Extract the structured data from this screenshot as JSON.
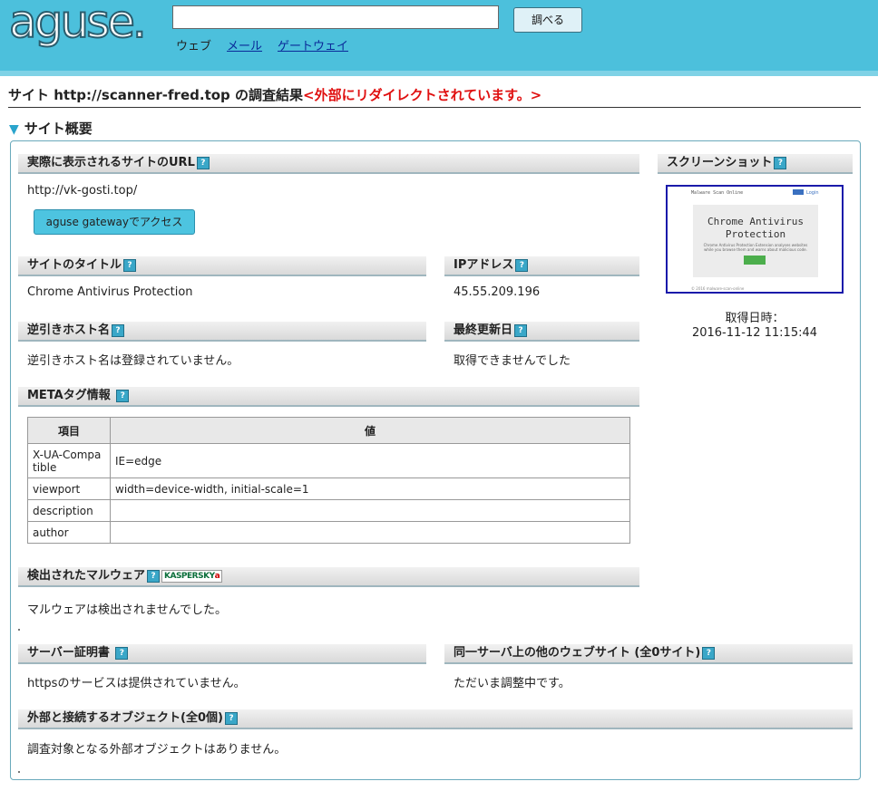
{
  "header": {
    "logo": "aguse.",
    "search_placeholder": "",
    "search_button": "調べる",
    "nav": [
      "ウェブ",
      "メール",
      "ゲートウェイ"
    ]
  },
  "page_title": {
    "prefix": "サイト http://scanner-fred.top の調査結果",
    "redirect_notice": "<外部にリダイレクトされています。>"
  },
  "section": {
    "title": "サイト概要"
  },
  "actual_url": {
    "label": "実際に表示されるサイトのURL",
    "value": "http://vk-gosti.top/",
    "gateway_button": "aguse gatewayでアクセス"
  },
  "screenshot": {
    "label": "スクリーンショット",
    "nav_text": "Malware Scan Online",
    "site_title": "Chrome Antivirus Protection",
    "site_desc": "Chrome Antivirus Protection Extension analyses websites while you browse them and warns about malicious code.",
    "button_text": "Install",
    "footer_text": "© 2016 malware-scan-online",
    "date_label": "取得日時：",
    "date_value": "2016-11-12 11:15:44"
  },
  "site_title": {
    "label": "サイトのタイトル",
    "value": "Chrome Antivirus Protection"
  },
  "ip": {
    "label": "IPアドレス",
    "value": "45.55.209.196"
  },
  "reverse_host": {
    "label": "逆引きホスト名",
    "value": "逆引きホスト名は登録されていません。"
  },
  "last_modified": {
    "label": "最終更新日",
    "value": "取得できませんでした"
  },
  "meta": {
    "label": "METAタグ情報",
    "columns": [
      "項目",
      "値"
    ],
    "rows": [
      {
        "key": "X-UA-Compatible",
        "value": "IE=edge"
      },
      {
        "key": "viewport",
        "value": "width=device-width, initial-scale=1"
      },
      {
        "key": "description",
        "value": ""
      },
      {
        "key": "author",
        "value": ""
      }
    ]
  },
  "malware": {
    "label": "検出されたマルウェア",
    "vendor": "KASPERSKY",
    "vendor_mark": "a",
    "value": "マルウェアは検出されませんでした。"
  },
  "certificate": {
    "label": "サーバー証明書",
    "value": "httpsのサービスは提供されていません。"
  },
  "same_server": {
    "label": "同一サーバ上の他のウェブサイト (全0サイト)",
    "value": "ただいま調整中です。"
  },
  "external": {
    "label": "外部と接続するオブジェクト(全0個)",
    "value": "調査対象となる外部オブジェクトはありません。"
  },
  "help_glyph": "?"
}
